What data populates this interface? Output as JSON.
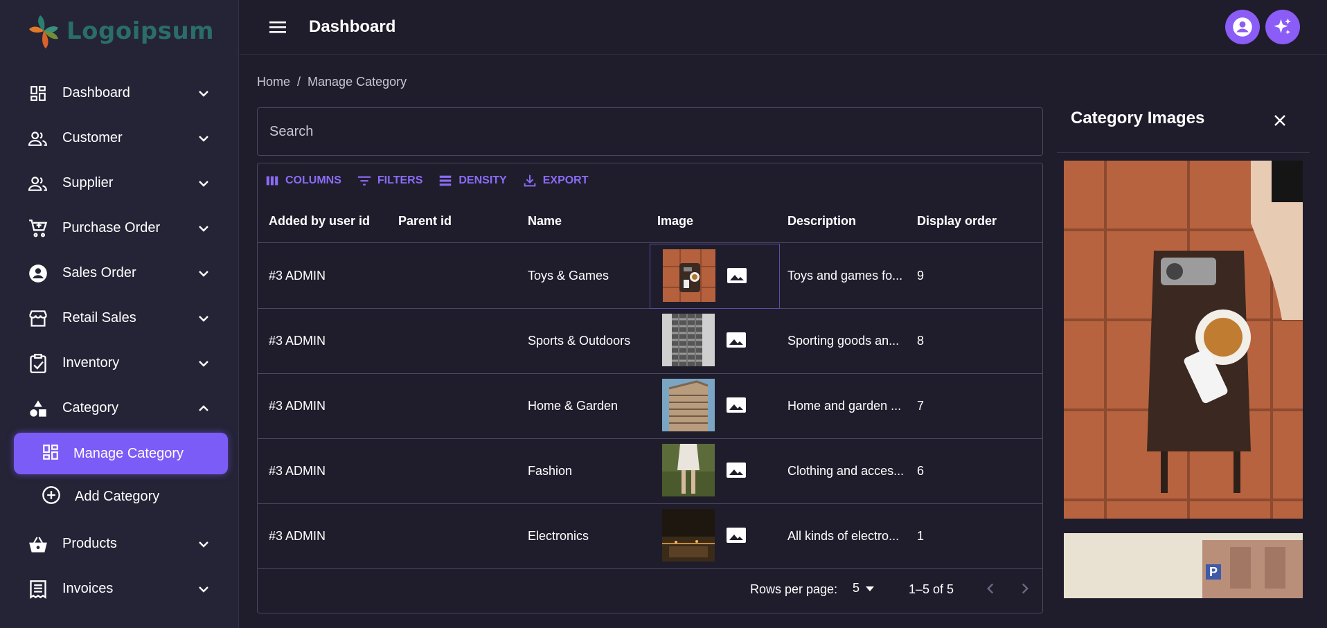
{
  "logo": {
    "text": "Logoipsum"
  },
  "sidebar": {
    "items": [
      {
        "label": "Dashboard",
        "icon": "dashboard-icon"
      },
      {
        "label": "Customer",
        "icon": "people-icon"
      },
      {
        "label": "Supplier",
        "icon": "people-icon"
      },
      {
        "label": "Purchase Order",
        "icon": "cart-icon"
      },
      {
        "label": "Sales Order",
        "icon": "account-circle-icon"
      },
      {
        "label": "Retail Sales",
        "icon": "store-icon"
      },
      {
        "label": "Inventory",
        "icon": "clipboard-check-icon"
      },
      {
        "label": "Category",
        "icon": "shapes-icon",
        "expanded": true
      },
      {
        "label": "Products",
        "icon": "basket-icon"
      },
      {
        "label": "Invoices",
        "icon": "receipt-icon"
      }
    ],
    "category_sub": [
      {
        "label": "Manage Category",
        "icon": "dashboard-icon",
        "active": true
      },
      {
        "label": "Add Category",
        "icon": "add-circle-icon"
      }
    ]
  },
  "header": {
    "title": "Dashboard"
  },
  "breadcrumb": {
    "home": "Home",
    "separator": "/",
    "current": "Manage Category"
  },
  "search": {
    "placeholder": "Search",
    "value": ""
  },
  "toolbar": {
    "columns": "COLUMNS",
    "filters": "FILTERS",
    "density": "DENSITY",
    "export": "EXPORT"
  },
  "table": {
    "headers": [
      "Added by user id",
      "Parent id",
      "Name",
      "Image",
      "Description",
      "Display order"
    ],
    "rows": [
      {
        "added_by": "#3 ADMIN",
        "parent": "",
        "name": "Toys & Games",
        "description": "Toys and games fo...",
        "order": "9"
      },
      {
        "added_by": "#3 ADMIN",
        "parent": "",
        "name": "Sports & Outdoors",
        "description": "Sporting goods an...",
        "order": "8"
      },
      {
        "added_by": "#3 ADMIN",
        "parent": "",
        "name": "Home & Garden",
        "description": "Home and garden ...",
        "order": "7"
      },
      {
        "added_by": "#3 ADMIN",
        "parent": "",
        "name": "Fashion",
        "description": "Clothing and acces...",
        "order": "6"
      },
      {
        "added_by": "#3 ADMIN",
        "parent": "",
        "name": "Electronics",
        "description": "All kinds of electro...",
        "order": "1"
      }
    ]
  },
  "pagination": {
    "rows_per_page_label": "Rows per page:",
    "rows_per_page": "5",
    "range": "1–5 of 5"
  },
  "panel": {
    "title": "Category Images"
  },
  "colors": {
    "accent": "#7c5cf7",
    "background": "#1f1d2b",
    "sidebar": "#252336",
    "link": "#8b6cf7"
  }
}
